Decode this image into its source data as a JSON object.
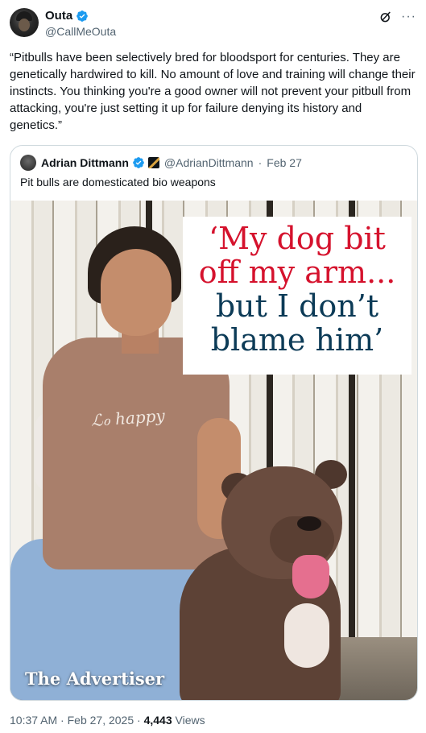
{
  "author": {
    "display_name": "Outa",
    "handle": "@CallMeOuta",
    "avatar_icon": "avatar",
    "verified_icon": "verified-badge-icon",
    "verified_color": "#1d9bf0"
  },
  "top_actions": {
    "grok_icon": "grok-icon",
    "more_label": "···"
  },
  "tweet": {
    "text": "“Pitbulls have been selectively bred for bloodsport for centuries. They are genetically hardwired to kill. No amount of love and training will change their instincts. You thinking you're a good owner will not prevent your pitbull from attacking, you're just setting it up for failure denying its history and genetics.”"
  },
  "quoted_tweet": {
    "display_name": "Adrian Dittmann",
    "flag_icon": "flag-icon",
    "handle": "@AdrianDittmann",
    "separator": "·",
    "date": "Feb 27",
    "text": "Pit bulls are domesticated bio weapons",
    "media": {
      "headline_line1": "‘My dog bit",
      "headline_line2": "off my arm...",
      "headline_line3": "but I don’t",
      "headline_line4": "blame him’",
      "shirt_print": "ℒℴ happy",
      "watermark": "The Advertiser",
      "headline_red": "#d5122d",
      "headline_navy": "#0c3b57"
    }
  },
  "meta": {
    "time": "10:37 AM",
    "separator1": "·",
    "date": "Feb 27, 2025",
    "separator2": "·",
    "views_count": "4,443",
    "views_label": "Views"
  }
}
